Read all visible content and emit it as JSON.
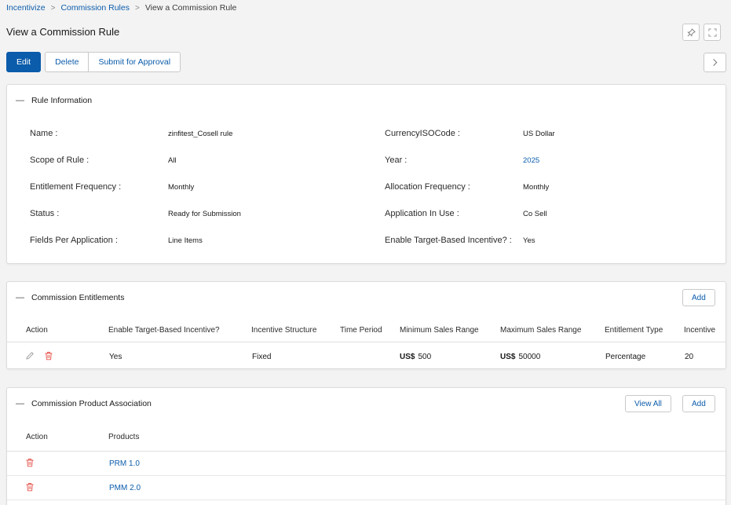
{
  "breadcrumb": {
    "items": [
      "Incentivize",
      "Commission Rules"
    ],
    "current": "View a Commission Rule"
  },
  "page": {
    "title": "View a Commission Rule"
  },
  "toolbar": {
    "edit_label": "Edit",
    "delete_label": "Delete",
    "submit_label": "Submit for Approval"
  },
  "rule_info": {
    "title": "Rule Information",
    "left": [
      {
        "label": "Name :",
        "value": "zinfitest_Cosell rule"
      },
      {
        "label": "Scope of Rule :",
        "value": "All"
      },
      {
        "label": "Entitlement Frequency :",
        "value": "Monthly"
      },
      {
        "label": "Status :",
        "value": "Ready for Submission"
      },
      {
        "label": "Fields Per Application :",
        "value": "Line Items"
      }
    ],
    "right": [
      {
        "label": "CurrencyISOCode :",
        "value": "US Dollar"
      },
      {
        "label": "Year :",
        "value": "2025"
      },
      {
        "label": "Allocation Frequency :",
        "value": "Monthly"
      },
      {
        "label": "Application In Use :",
        "value": "Co Sell"
      },
      {
        "label": "Enable Target-Based Incentive? :",
        "value": "Yes"
      }
    ]
  },
  "entitlements": {
    "title": "Commission Entitlements",
    "add_label": "Add",
    "columns": [
      "Action",
      "Enable Target-Based Incentive?",
      "Incentive Structure",
      "Time Period",
      "Minimum Sales Range",
      "Maximum Sales Range",
      "Entitlement Type",
      "Incentive"
    ],
    "rows": [
      {
        "target_based": "Yes",
        "structure": "Fixed",
        "time_period": "",
        "min_currency": "US$",
        "min_value": "500",
        "max_currency": "US$",
        "max_value": "50000",
        "entitlement_type": "Percentage",
        "incentive": "20"
      }
    ]
  },
  "products": {
    "title": "Commission Product Association",
    "view_all_label": "View All",
    "add_label": "Add",
    "columns": [
      "Action",
      "Products"
    ],
    "rows": [
      {
        "product": "PRM 1.0"
      },
      {
        "product": "PMM 2.0"
      }
    ]
  },
  "colors": {
    "brand": "#0b5cab",
    "delete": "#e5534b",
    "edit": "#9a9a9a"
  },
  "icons": {
    "pin": "pin-icon",
    "expand": "expand-icon",
    "next": "chevron-right-icon",
    "edit": "pencil-icon",
    "delete": "trash-icon"
  }
}
